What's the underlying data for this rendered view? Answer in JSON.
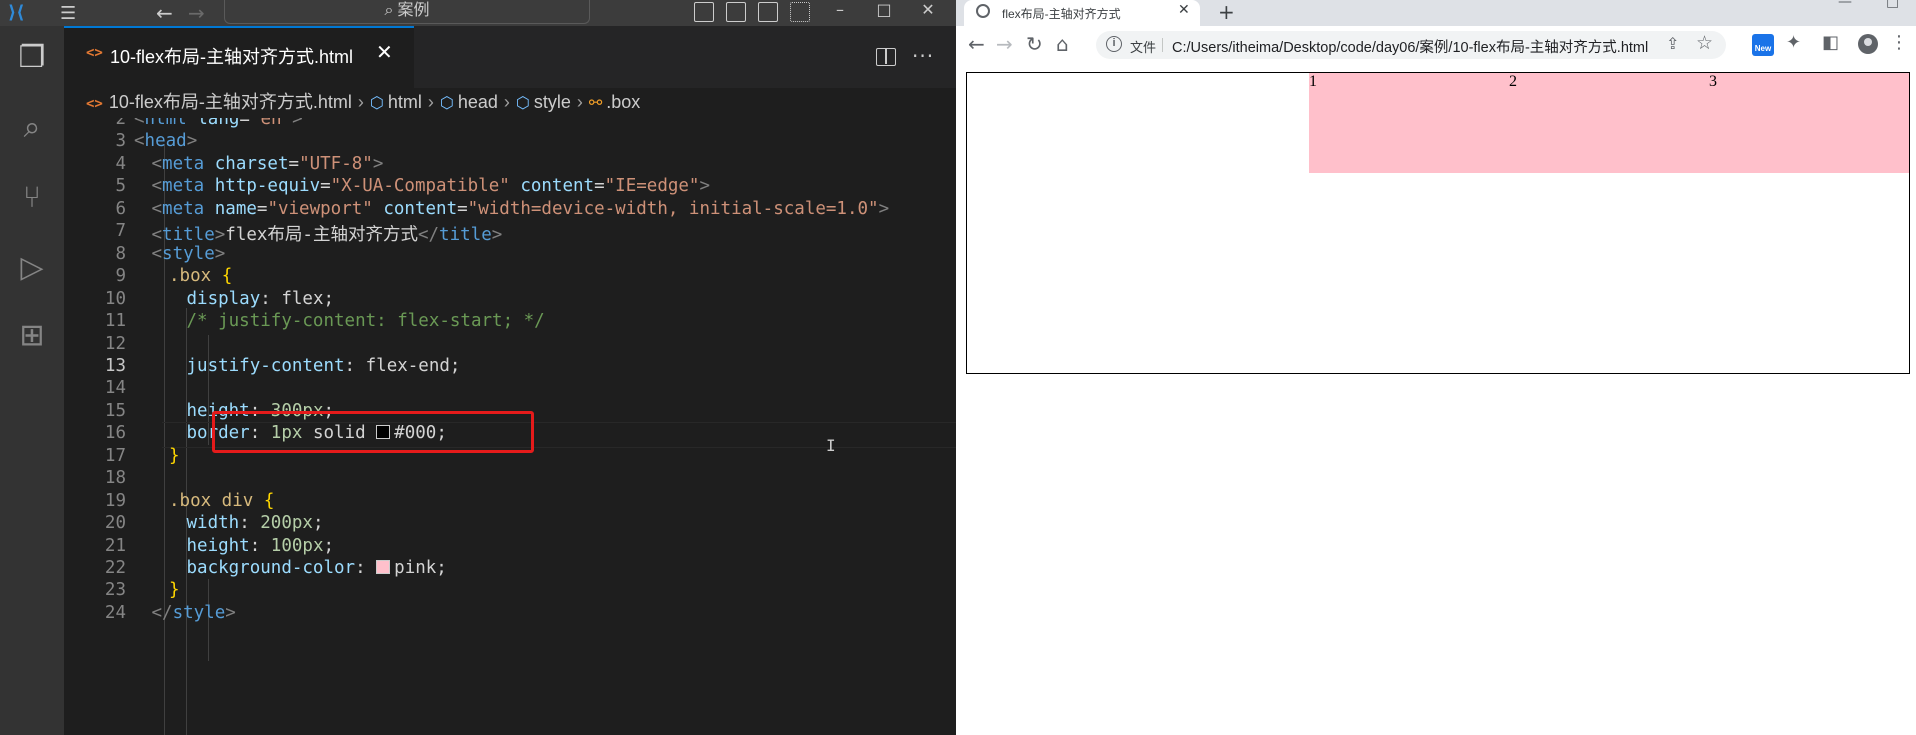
{
  "vscode": {
    "search_label": "案例",
    "tab": {
      "title": "10-flex布局-主轴对齐方式.html",
      "icon_text": "<>",
      "close": "✕"
    },
    "breadcrumb": [
      {
        "icon": "html-file-icon",
        "label": "10-flex布局-主轴对齐方式.html"
      },
      {
        "icon": "cube-icon",
        "label": "html"
      },
      {
        "icon": "cube-icon",
        "label": "head"
      },
      {
        "icon": "cube-icon",
        "label": "style"
      },
      {
        "icon": "property-icon",
        "label": ".box"
      }
    ],
    "active_line": "13",
    "highlighted_line": "13",
    "colors": {
      "highlight_box": "#e51b1b",
      "accent": "#0078d4"
    },
    "code_lines": [
      {
        "num": "2",
        "text": "<html lang=\"en\">"
      },
      {
        "num": "3",
        "text": "<head>"
      },
      {
        "num": "4",
        "text": "<meta charset=\"UTF-8\">"
      },
      {
        "num": "5",
        "text": "<meta http-equiv=\"X-UA-Compatible\" content=\"IE=edge\">"
      },
      {
        "num": "6",
        "text": "<meta name=\"viewport\" content=\"width=device-width, initial-scale=1.0\">"
      },
      {
        "num": "7",
        "text": "<title>flex布局-主轴对齐方式</title>"
      },
      {
        "num": "8",
        "text": "<style>"
      },
      {
        "num": "9",
        "text": ".box {"
      },
      {
        "num": "10",
        "text": "display: flex;"
      },
      {
        "num": "11",
        "text": "/* justify-content: flex-start; */"
      },
      {
        "num": "12",
        "text": ""
      },
      {
        "num": "13",
        "text": "justify-content: flex-end;"
      },
      {
        "num": "14",
        "text": ""
      },
      {
        "num": "15",
        "text": "height: 300px;"
      },
      {
        "num": "16",
        "text": "border: 1px solid #000;"
      },
      {
        "num": "17",
        "text": "}"
      },
      {
        "num": "18",
        "text": ""
      },
      {
        "num": "19",
        "text": ".box div {"
      },
      {
        "num": "20",
        "text": "width: 200px;"
      },
      {
        "num": "21",
        "text": "height: 100px;"
      },
      {
        "num": "22",
        "text": "background-color: pink;"
      },
      {
        "num": "23",
        "text": "}"
      },
      {
        "num": "24",
        "text": "</style>"
      }
    ]
  },
  "browser": {
    "tab_title": "flex布局-主轴对齐方式",
    "tab_close": "✕",
    "new_tab": "+",
    "omnibox": {
      "security_label": "文件",
      "url": "C:/Users/itheima/Desktop/code/day06/案例/10-flex布局-主轴对齐方式.html"
    },
    "new_badge": "New",
    "page": {
      "items": [
        "1",
        "2",
        "3"
      ],
      "item_color": "#ffc0cb",
      "justify": "flex-end"
    }
  }
}
